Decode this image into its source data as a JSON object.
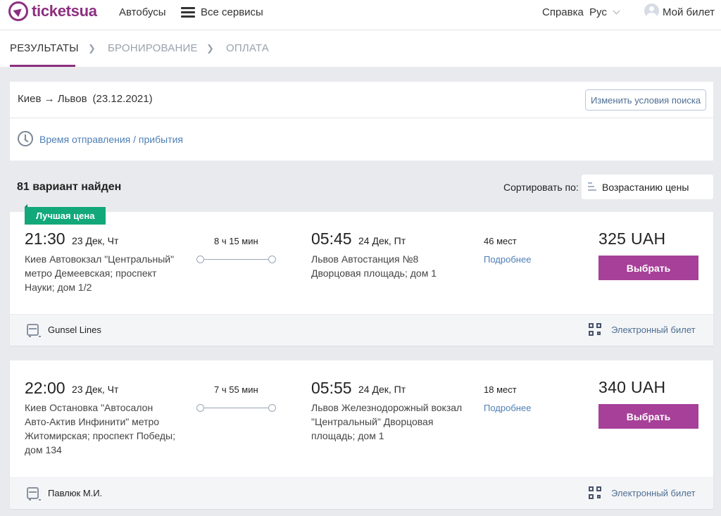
{
  "header": {
    "logo": "ticketsua",
    "nav": {
      "buses": "Автобусы",
      "all_services": "Все сервисы"
    },
    "help": "Справка",
    "language": "Рус",
    "my_ticket": "Мой билет"
  },
  "steps": {
    "items": [
      "РЕЗУЛЬТАТЫ",
      "БРОНИРОВАНИЕ",
      "ОПЛАТА"
    ],
    "active": 0,
    "separator": "❯"
  },
  "search": {
    "route": "Киев → Львов",
    "date": "(23.12.2021)",
    "change_button": "Изменить условия поиска",
    "time_filter": "Время отправления / прибытия"
  },
  "results": {
    "count_text": "81 вариант найден",
    "sort_label": "Сортировать по:",
    "sort_value": "Возрастанию цены"
  },
  "trips": [
    {
      "badge": "Лучшая цена",
      "dep_time": "21:30",
      "dep_date": "23 Дек, Чт",
      "dep_addr": [
        "Киев Автовокзал \"Центральный\"",
        "метро Демеевская; проспект",
        "Науки; дом 1/2"
      ],
      "duration": "8 ч 15 мин",
      "arr_time": "05:45",
      "arr_date": "24 Дек, Пт",
      "arr_addr": [
        "Львов Автостанция №8",
        "Дворцовая площадь; дом 1"
      ],
      "seats": "46 мест",
      "details": "Подробнее",
      "price": "325  UAH",
      "choose": "Выбрать",
      "carrier": "Gunsel Lines",
      "ticket_type": "Электронный билет"
    },
    {
      "badge": "",
      "dep_time": "22:00",
      "dep_date": "23 Дек, Чт",
      "dep_addr": [
        "Киев Остановка \"Автосалон",
        "Авто-Актив Инфинити\" метро",
        "Житомирская; проспект Победы;",
        "дом 134"
      ],
      "duration": "7 ч 55 мин",
      "arr_time": "05:55",
      "arr_date": "24 Дек, Пт",
      "arr_addr": [
        "Львов Железнодорожный вокзал",
        "\"Центральный\" Дворцовая",
        "площадь; дом 1"
      ],
      "seats": "18 мест",
      "details": "Подробнее",
      "price": "340  UAH",
      "choose": "Выбрать",
      "carrier": "Павлюк М.И.",
      "ticket_type": "Электронный билет"
    }
  ],
  "colors": {
    "brand": "#8c2f7f",
    "button": "#a74099",
    "badge": "#12a87a",
    "link": "#4e7fb6"
  },
  "icons": [
    "logo-icon",
    "menu-icon",
    "chevron-down-icon",
    "user-icon",
    "clock-icon",
    "sort-icon",
    "bus-icon",
    "qr-code-icon"
  ]
}
